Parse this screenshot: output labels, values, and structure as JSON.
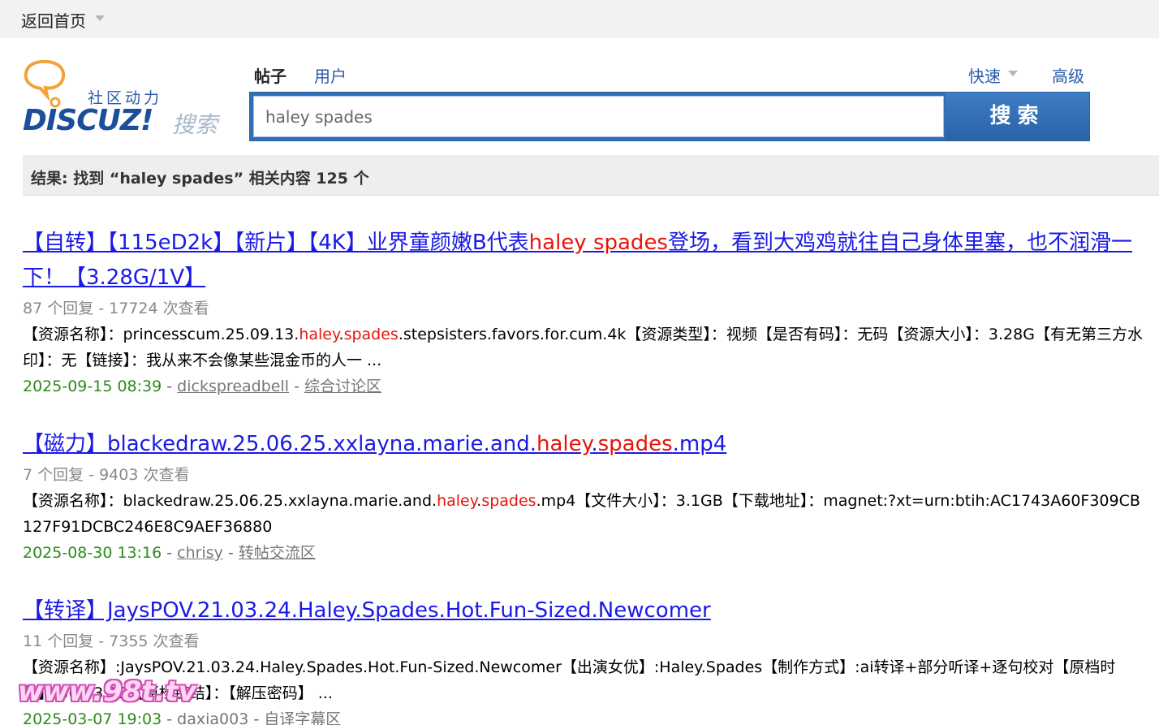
{
  "topbar": {
    "home_label": "返回首页"
  },
  "logo": {
    "slogan": "社区动力",
    "brand": "DISCUZ!",
    "suffix": "搜索"
  },
  "search": {
    "tab_posts": "帖子",
    "tab_users": "用户",
    "quick_label": "快速",
    "advanced_label": "高级",
    "query": "haley spades",
    "button_label": "搜索"
  },
  "result_summary": "结果: 找到 “haley spades” 相关内容 125 个",
  "results": [
    {
      "title_pre": "【自转】【115eD2k】【新片】【4K】业界童颜嫩B代表",
      "title_hl": "haley spades",
      "title_post": "登场，看到大鸡鸡就往自己身体里塞，也不润滑一下！【3.28G/1V】",
      "meta": "87 个回复 - 17724 次查看",
      "body_pre": "【资源名称】：princesscum.25.09.13.",
      "body_hl1": "haley",
      "body_mid": ".",
      "body_hl2": "spades",
      "body_post": ".stepsisters.favors.for.cum.4k【资源类型】：视频【是否有码】：无码【资源大小】：3.28G【有无第三方水印】：无【链接】：我从来不会像某些混金币的人一 ...",
      "date": "2025-09-15 08:39",
      "author": "dickspreadbell",
      "forum": "综合讨论区"
    },
    {
      "title_pre": "【磁力】blackedraw.25.06.25.xxlayna.marie.and.",
      "title_hl1": "haley",
      "title_mid": ".",
      "title_hl2": "spades",
      "title_post": ".mp4",
      "meta": "7 个回复 - 9403 次查看",
      "body_pre": "【资源名称】：blackedraw.25.06.25.xxlayna.marie.and.",
      "body_hl1": "haley",
      "body_mid": ".",
      "body_hl2": "spades",
      "body_post": ".mp4【文件大小】：3.1GB【下载地址】：magnet:?xt=urn:btih:AC1743A60F309CB127F91DCBC246E8C9AEF36880",
      "date": "2025-08-30 13:16",
      "author": "chrisy",
      "forum": "转帖交流区"
    },
    {
      "title": "【转译】JaysPOV.21.03.24.Haley.Spades.Hot.Fun-Sized.Newcomer",
      "meta": "11 个回复 - 7355 次查看",
      "body": "【资源名称】:JaysPOV.21.03.24.Haley.Spades.Hot.Fun-Sized.Newcomer【出演女优】:Haley.Spades【制作方式】:ai转译+部分听译+逐句校对【原档时长】:00:33:13【原档链结】：【解压密码】 ...",
      "date": "2025-03-07 19:03",
      "author": "daxia003",
      "forum": "自译字幕区"
    }
  ],
  "watermark": {
    "text": "www.98t.tv"
  },
  "colors": {
    "accent_blue": "#2f6fb5",
    "link_blue": "#1a1ae6",
    "highlight_red": "#e8140c",
    "date_green": "#2e8b1a"
  }
}
